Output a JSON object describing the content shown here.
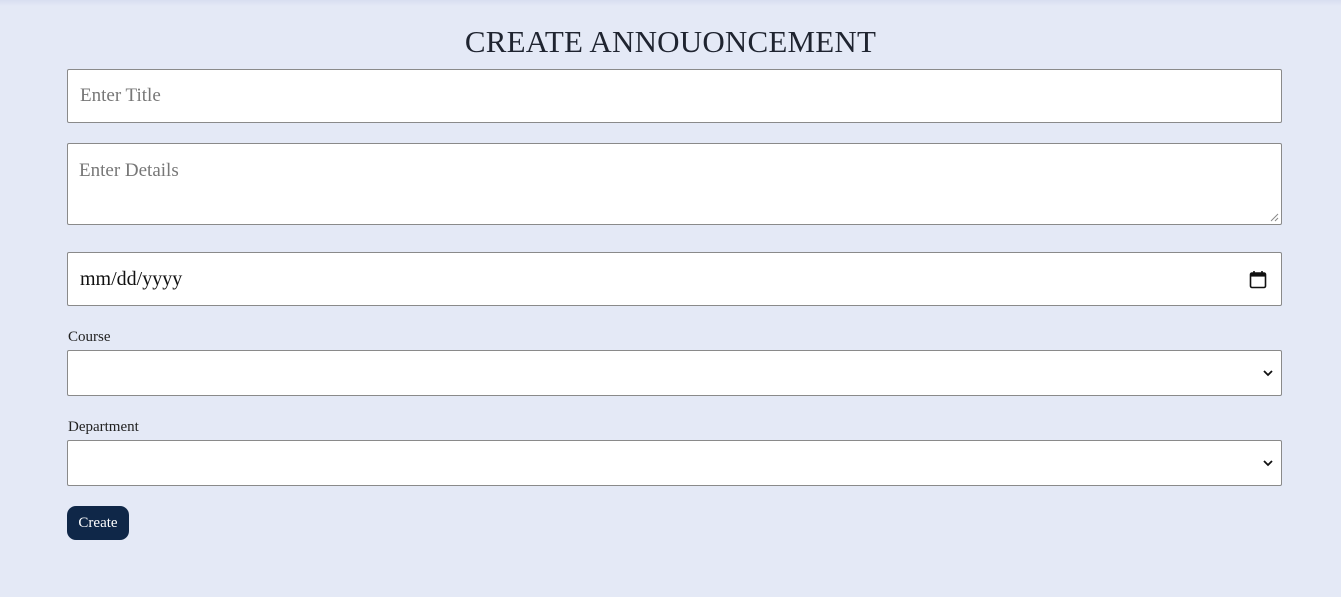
{
  "header": {
    "title": "CREATE ANNOUONCEMENT"
  },
  "form": {
    "title_field": {
      "placeholder": "Enter Title",
      "value": ""
    },
    "details_field": {
      "placeholder": "Enter Details",
      "value": ""
    },
    "date_field": {
      "placeholder": "mm/dd/yyyy",
      "value": "",
      "icon": "calendar-icon"
    },
    "course_field": {
      "label": "Course",
      "selected": "",
      "icon": "chevron-down-icon"
    },
    "department_field": {
      "label": "Department",
      "selected": "",
      "icon": "chevron-down-icon"
    },
    "submit_label": "Create"
  },
  "colors": {
    "background": "#e4e9f6",
    "button": "#0f2748",
    "button_text": "#ffffff",
    "field_border": "#8a8a8a"
  }
}
